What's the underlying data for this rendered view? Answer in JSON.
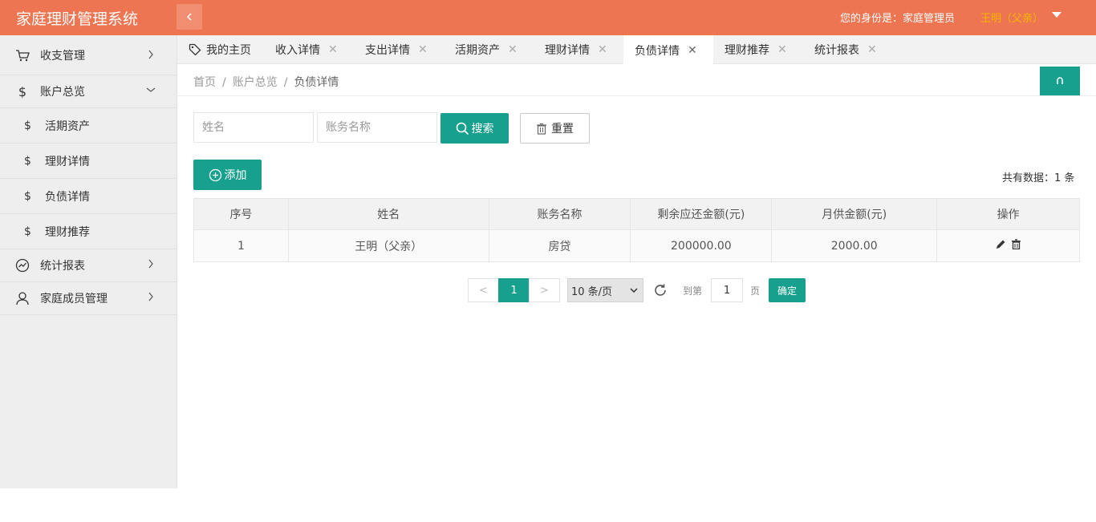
{
  "app": {
    "title": "家庭理财管理系统"
  },
  "header": {
    "role_text": "您的身份是：家庭管理员",
    "user_name": "王明（父亲）"
  },
  "sidebar": {
    "items": [
      {
        "label": "收支管理"
      },
      {
        "label": "账户总览"
      },
      {
        "label": "统计报表"
      },
      {
        "label": "家庭成员管理"
      }
    ],
    "sub_items": [
      {
        "label": "活期资产"
      },
      {
        "label": "理财详情"
      },
      {
        "label": "负债详情"
      },
      {
        "label": "理财推荐"
      }
    ],
    "dollar": "$"
  },
  "tabs": [
    {
      "label": "我的主页"
    },
    {
      "label": "收入详情"
    },
    {
      "label": "支出详情"
    },
    {
      "label": "活期资产"
    },
    {
      "label": "理财详情"
    },
    {
      "label": "负债详情"
    },
    {
      "label": "理财推荐"
    },
    {
      "label": "统计报表"
    }
  ],
  "tab_close": "✕",
  "breadcrumb": {
    "home": "首页",
    "parent": "账户总览",
    "current": "负债详情",
    "sep": "/"
  },
  "search": {
    "name_placeholder": "姓名",
    "account_placeholder": "账务名称",
    "search_label": "搜索",
    "reset_label": "重置"
  },
  "toolbar": {
    "add_label": "添加",
    "total_text": "共有数据：1 条"
  },
  "table": {
    "headers": [
      "序号",
      "姓名",
      "账务名称",
      "剩余应还金额(元)",
      "月供金额(元)",
      "操作"
    ],
    "rows": [
      {
        "index": "1",
        "name": "王明（父亲）",
        "account": "房贷",
        "remaining": "200000.00",
        "monthly": "2000.00"
      }
    ]
  },
  "pagination": {
    "prev": "<",
    "next": ">",
    "current_page": "1",
    "page_size": "10 条/页",
    "goto_label": "到第",
    "page_unit": "页",
    "goto_value": "1",
    "confirm_label": "确定"
  },
  "colors": {
    "header_bg": "#ee7552",
    "accent": "#16a08d",
    "user_name": "#f5b800"
  }
}
